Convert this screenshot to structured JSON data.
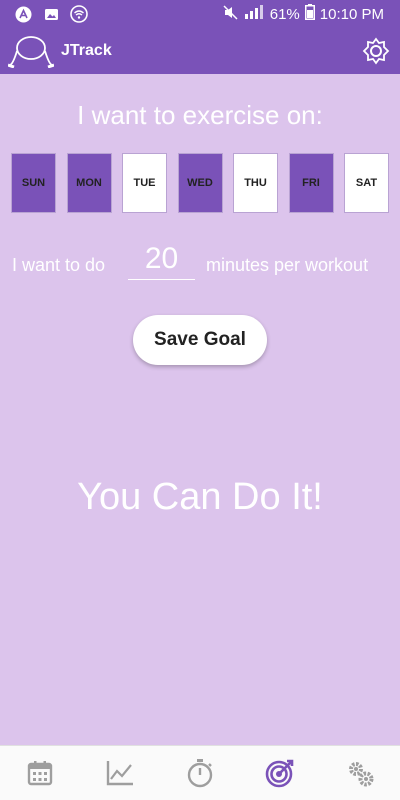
{
  "status": {
    "battery": "61%",
    "time": "10:10 PM"
  },
  "app": {
    "title": "JTrack"
  },
  "goal": {
    "heading": "I want to exercise on:",
    "days": [
      {
        "label": "SUN",
        "selected": true
      },
      {
        "label": "MON",
        "selected": true
      },
      {
        "label": "TUE",
        "selected": false
      },
      {
        "label": "WED",
        "selected": true
      },
      {
        "label": "THU",
        "selected": false
      },
      {
        "label": "FRI",
        "selected": true
      },
      {
        "label": "SAT",
        "selected": false
      }
    ],
    "minutes_prefix": "I want to do",
    "minutes_value": "20",
    "minutes_suffix": "minutes per workout",
    "save_label": "Save Goal",
    "motto": "You Can Do It!"
  },
  "nav": {
    "items": [
      {
        "icon": "calendar-icon",
        "active": false
      },
      {
        "icon": "chart-icon",
        "active": false
      },
      {
        "icon": "stopwatch-icon",
        "active": false
      },
      {
        "icon": "target-icon",
        "active": true
      },
      {
        "icon": "gears-icon",
        "active": false
      }
    ]
  },
  "colors": {
    "primary": "#7a52b8",
    "background": "#dcc4ec",
    "nav_inactive": "#9e9e9e",
    "nav_active": "#7a52b8"
  }
}
